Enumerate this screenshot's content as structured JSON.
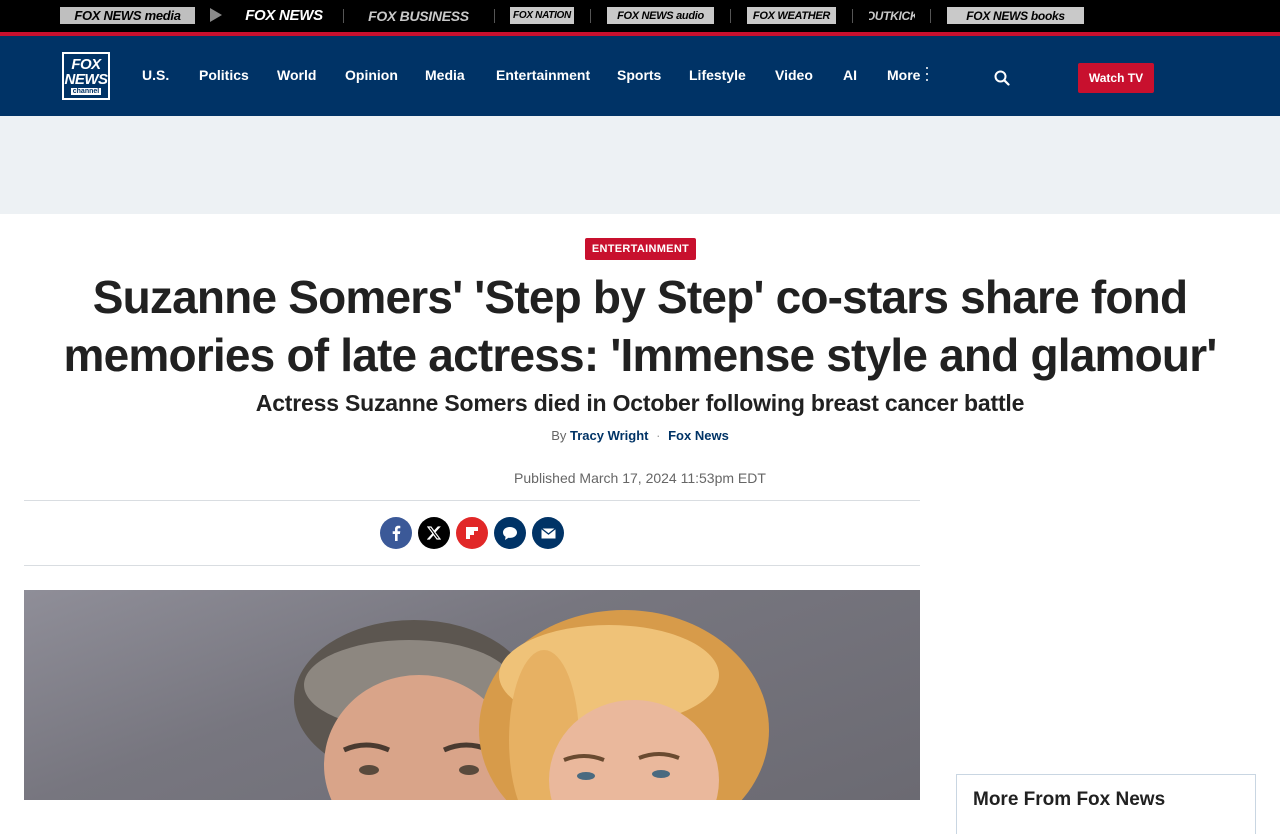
{
  "network_bar": {
    "items": [
      {
        "label": "FOX NEWS media",
        "color": "#bfbfbf"
      },
      {
        "label": "FOX NEWS",
        "color": "#ffffff"
      },
      {
        "label": "FOX BUSINESS",
        "color": "#c9c9c9"
      },
      {
        "label": "FOX NATION",
        "color": "#c9c9c9"
      },
      {
        "label": "FOX NEWS audio",
        "color": "#c9c9c9"
      },
      {
        "label": "FOX WEATHER",
        "color": "#c9c9c9"
      },
      {
        "label": "OUTKICK",
        "color": "#c9c9c9"
      },
      {
        "label": "FOX NEWS books",
        "color": "#c9c9c9"
      }
    ],
    "accent_color": "#c8102e"
  },
  "header": {
    "logo": {
      "line1": "FOX",
      "line2": "NEWS",
      "line3": "channel"
    },
    "nav": [
      "U.S.",
      "Politics",
      "World",
      "Opinion",
      "Media",
      "Entertainment",
      "Sports",
      "Lifestyle",
      "Video",
      "AI",
      "More"
    ],
    "search_icon": "search-icon",
    "watch_tv": "Watch TV",
    "background": "#003366"
  },
  "article": {
    "category": "ENTERTAINMENT",
    "headline": "Suzanne Somers' 'Step by Step' co-stars share fond memories of late actress: 'Immense style and glamour'",
    "subhead": "Actress Suzanne Somers died in October following breast cancer battle",
    "byline": {
      "by": "By",
      "author": "Tracy Wright",
      "source": "Fox News"
    },
    "published": "Published March 17, 2024 11:53pm EDT",
    "share_icons": [
      {
        "name": "facebook-icon",
        "color": "#3b5998"
      },
      {
        "name": "x-twitter-icon",
        "color": "#000000"
      },
      {
        "name": "flipboard-icon",
        "color": "#e12828"
      },
      {
        "name": "comment-icon",
        "color": "#003366"
      },
      {
        "name": "email-icon",
        "color": "#003366"
      }
    ]
  },
  "sidebar": {
    "more_from_title": "More From Fox News"
  }
}
